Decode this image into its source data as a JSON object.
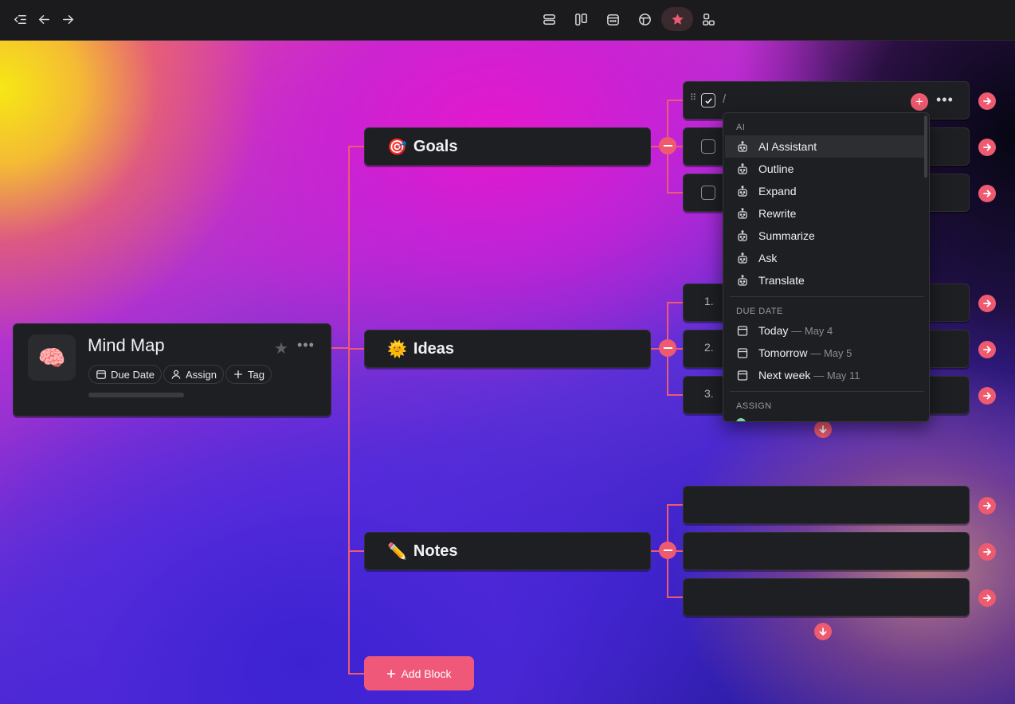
{
  "root": {
    "title": "Mind Map",
    "emoji": "🧠",
    "chips": [
      "Due Date",
      "Assign",
      "Tag"
    ]
  },
  "branches": [
    {
      "emoji": "🎯",
      "label": "Goals"
    },
    {
      "emoji": "🌞",
      "label": "Ideas"
    },
    {
      "emoji": "✏️",
      "label": "Notes"
    }
  ],
  "leaves": {
    "goals_active": {
      "slash": "/"
    },
    "ideas_numbers": [
      "1.",
      "2.",
      "3."
    ]
  },
  "add_block": "Add Block",
  "menu": {
    "ai_header": "AI",
    "ai_items": [
      "AI Assistant",
      "Outline",
      "Expand",
      "Rewrite",
      "Summarize",
      "Ask",
      "Translate"
    ],
    "due_header": "DUE DATE",
    "due_items": [
      {
        "label": "Today",
        "sub": "— May 4"
      },
      {
        "label": "Tomorrow",
        "sub": "— May 5"
      },
      {
        "label": "Next week",
        "sub": "— May 11"
      }
    ],
    "assign_header": "ASSIGN"
  },
  "colors": {
    "accent": "#ee5a6f",
    "card": "#1e1f22"
  }
}
